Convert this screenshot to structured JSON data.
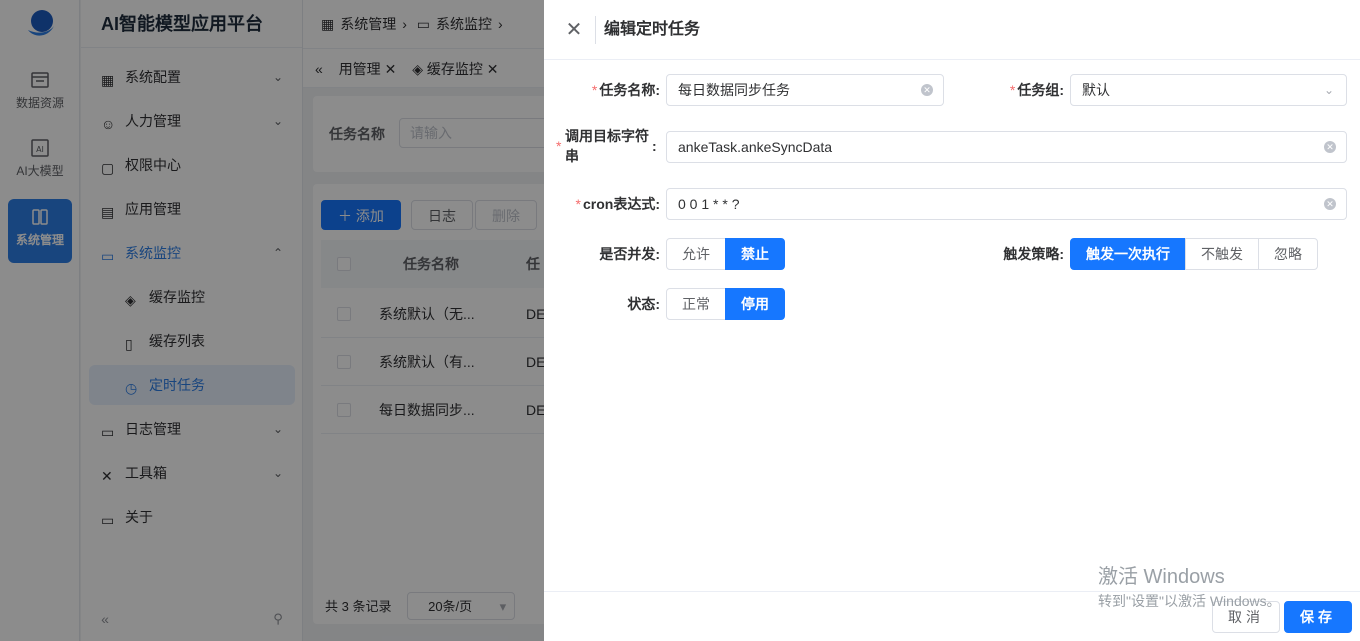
{
  "rail": {
    "items": [
      {
        "label": "数据资源",
        "icon": "dataset-icon"
      },
      {
        "label": "AI大模型",
        "icon": "ai-chip-icon"
      },
      {
        "label": "系统管理",
        "icon": "system-grid-icon"
      }
    ]
  },
  "sidebar": {
    "brand": "AI智能模型应用平台",
    "items": [
      {
        "label": "系统配置"
      },
      {
        "label": "人力管理"
      },
      {
        "label": "权限中心"
      },
      {
        "label": "应用管理"
      },
      {
        "label": "系统监控"
      },
      {
        "label": "缓存监控"
      },
      {
        "label": "缓存列表"
      },
      {
        "label": "定时任务"
      },
      {
        "label": "日志管理"
      },
      {
        "label": "工具箱"
      },
      {
        "label": "关于"
      }
    ]
  },
  "breadcrumb": {
    "items": [
      "系统管理",
      "系统监控"
    ]
  },
  "tabs": {
    "items": [
      "用管理",
      "缓存监控"
    ]
  },
  "search": {
    "label": "任务名称",
    "placeholder": "请输入"
  },
  "toolbar": {
    "add": "添加",
    "log": "日志",
    "delete": "删除"
  },
  "table": {
    "headers": [
      "任务名称",
      "任"
    ],
    "rows": [
      {
        "name": "系统默认（无...",
        "group": "DE"
      },
      {
        "name": "系统默认（有...",
        "group": "DE"
      },
      {
        "name": "每日数据同步...",
        "group": "DE"
      }
    ]
  },
  "pager": {
    "total": "共 3 条记录",
    "size": "20条/页"
  },
  "drawer": {
    "title": "编辑定时任务",
    "form": {
      "task_name_label": "任务名称:",
      "task_name_value": "每日数据同步任务",
      "task_group_label": "任务组:",
      "task_group_value": "默认",
      "target_label": "调用目标字符串",
      "target_colon": ":",
      "target_value": "ankeTask.ankeSyncData",
      "cron_label": "cron表达式:",
      "cron_value": "0 0 1 * * ?",
      "concurrent_label": "是否并发:",
      "concurrent_options": [
        "允许",
        "禁止"
      ],
      "concurrent_selected": "禁止",
      "misfire_label": "触发策略:",
      "misfire_options": [
        "触发一次执行",
        "不触发",
        "忽略"
      ],
      "misfire_selected": "触发一次执行",
      "status_label": "状态:",
      "status_options": [
        "正常",
        "停用"
      ],
      "status_selected": "停用"
    },
    "cancel": "取消",
    "save": "保存"
  },
  "watermark": {
    "line1": "激活 Windows",
    "line2": "转到\"设置\"以激活 Windows。"
  },
  "colors": {
    "primary": "#1677ff",
    "required": "#f56c6c",
    "overlay": "rgba(0,0,0,0.45)"
  }
}
